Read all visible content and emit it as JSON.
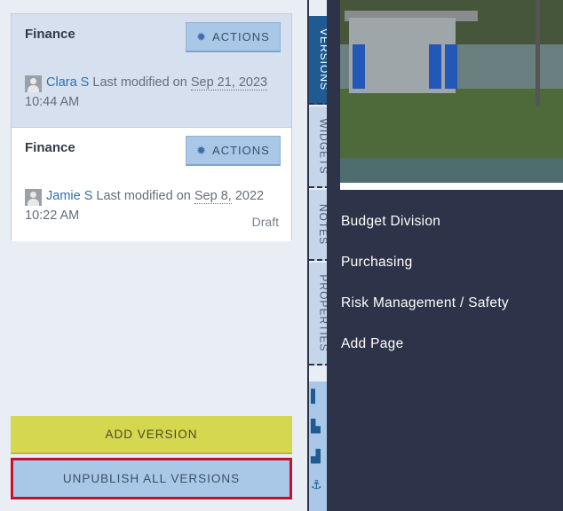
{
  "versions": [
    {
      "title": "Finance",
      "actions_label": "ACTIONS",
      "user": "Clara S",
      "modified_prefix": "Last modified on",
      "date": "Sep 21, 2023",
      "time": "10:44 AM",
      "status": ""
    },
    {
      "title": "Finance",
      "actions_label": "ACTIONS",
      "user": "Jamie S",
      "modified_prefix": "Last modified on",
      "date": "Sep 8,",
      "time": "2022 10:22 AM",
      "status": "Draft"
    }
  ],
  "buttons": {
    "add_version": "ADD VERSION",
    "unpublish_all": "UNPUBLISH ALL VERSIONS"
  },
  "tabs": [
    {
      "label": "VERSIONS",
      "active": true
    },
    {
      "label": "WIDGETS",
      "active": false
    },
    {
      "label": "NOTES",
      "active": false
    },
    {
      "label": "PROPERTIES",
      "active": false
    }
  ],
  "pages": [
    "Budget Division",
    "Purchasing",
    "Risk Management / Safety",
    "Add Page"
  ],
  "icons": {
    "gear": "gear-icon",
    "avatar": "avatar-icon",
    "anchor": "anchor-icon"
  },
  "colors": {
    "accent_blue": "#1f5b92",
    "button_blue": "#a9c8e8",
    "add_yellow": "#d5d74f",
    "highlight_red": "#c8102e",
    "navy": "#2d3348"
  }
}
